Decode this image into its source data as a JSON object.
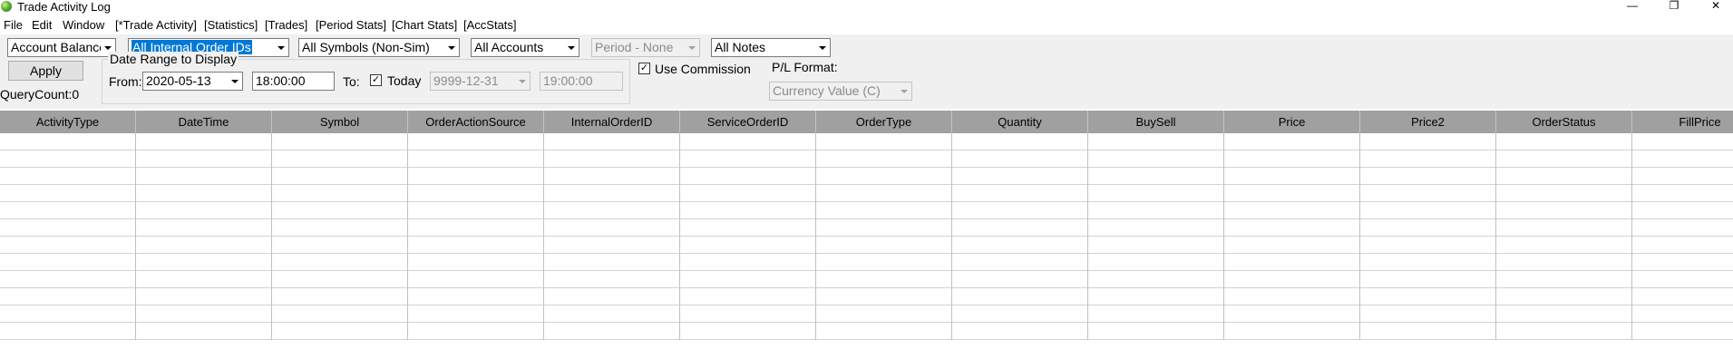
{
  "window": {
    "title": "Trade Activity Log",
    "minimize_glyph": "—",
    "restore_glyph": "❐",
    "close_glyph": "✕"
  },
  "menu": [
    "File",
    "Edit",
    "Window",
    "[*Trade Activity]",
    "[Statistics]",
    "[Trades]",
    "[Period Stats]",
    "[Chart Stats]",
    "[AccStats]"
  ],
  "controls": {
    "account_balance": "Account Balance",
    "order_ids": "All Internal Order IDs",
    "symbols": "All Symbols (Non-Sim)",
    "accounts": "All Accounts",
    "period": "Period - None",
    "notes": "All Notes",
    "apply": "Apply",
    "query_count": "QueryCount:0",
    "date_range_title": "Date Range to Display",
    "from_label": "From:",
    "from_date": "2020-05-13",
    "from_time": "18:00:00",
    "to_label": "To:",
    "today_checked": true,
    "today_label": "Today",
    "to_date": "9999-12-31",
    "to_time": "19:00:00",
    "use_commission_checked": true,
    "use_commission_label": "Use Commission",
    "pl_format_label": "P/L Format:",
    "pl_format_value": "Currency Value (C)"
  },
  "grid": {
    "columns": [
      "ActivityType",
      "DateTime",
      "Symbol",
      "OrderActionSource",
      "InternalOrderID",
      "ServiceOrderID",
      "OrderType",
      "Quantity",
      "BuySell",
      "Price",
      "Price2",
      "OrderStatus",
      "FillPrice"
    ],
    "empty_rows": 12
  }
}
